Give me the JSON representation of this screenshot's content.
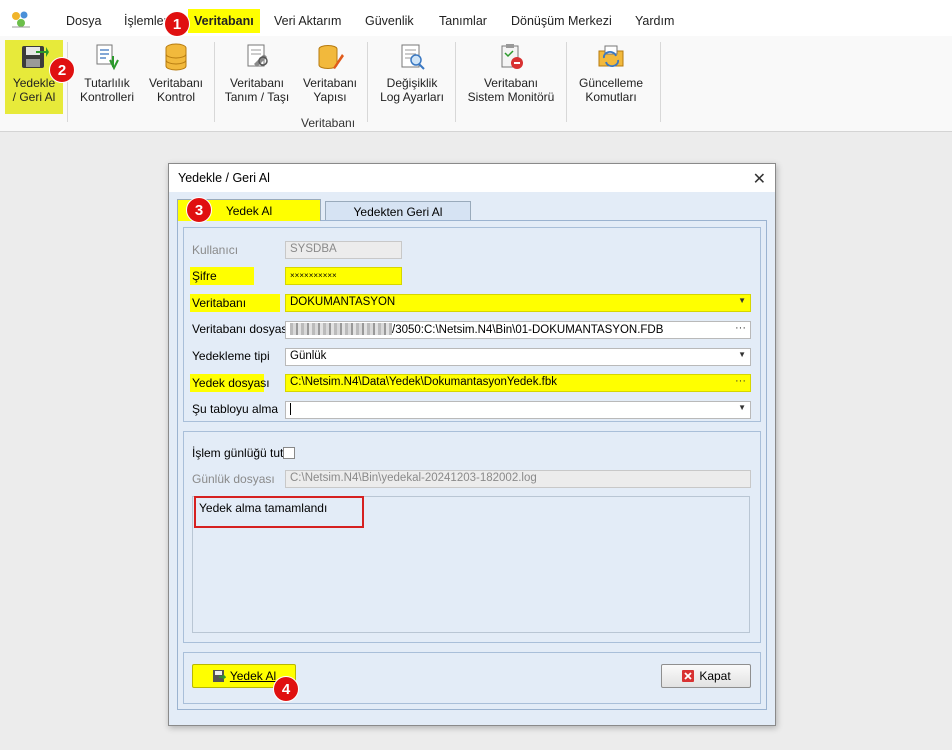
{
  "menu": {
    "items": [
      "Dosya",
      "İşlemler",
      "Veritabanı",
      "Veri Aktarım",
      "Güvenlik",
      "Tanımlar",
      "Dönüşüm Merkezi",
      "Yardım"
    ],
    "active": "Veritabanı"
  },
  "ribbon": {
    "buttons": [
      {
        "line1": "Yedekle",
        "line2": "/ Geri Al",
        "icon": "backup-restore-icon"
      },
      {
        "line1": "Tutarlılık",
        "line2": "Kontrolleri",
        "icon": "consistency-check-icon"
      },
      {
        "line1": "Veritabanı",
        "line2": "Kontrol",
        "icon": "database-icon"
      },
      {
        "line1": "Veritabanı",
        "line2": "Tanım / Taşı",
        "icon": "database-definition-icon"
      },
      {
        "line1": "Veritabanı",
        "line2": "Yapısı",
        "icon": "database-structure-icon"
      },
      {
        "line1": "Değişiklik",
        "line2": "Log Ayarları",
        "icon": "change-log-icon"
      },
      {
        "line1": "Veritabanı",
        "line2": "Sistem Monitörü",
        "icon": "system-monitor-icon"
      },
      {
        "line1": "Güncelleme",
        "line2": "Komutları",
        "icon": "update-commands-icon"
      }
    ],
    "group_label": "Veritabanı"
  },
  "badges": [
    "1",
    "2",
    "3",
    "4"
  ],
  "dialog": {
    "title": "Yedekle / Geri Al",
    "close": "✕",
    "tabs": [
      "Yedek Al",
      "Yedekten Geri Al"
    ],
    "fields": {
      "user_label": "Kullanıcı",
      "user_value": "SYSDBA",
      "password_label": "Şifre",
      "password_value": "××××××××××",
      "database_label": "Veritabanı",
      "database_value": "DOKUMANTASYON",
      "db_file_label": "Veritabanı dosyası",
      "db_file_value": "/3050:C:\\Netsim.N4\\Bin\\01-DOKUMANTASYON.FDB",
      "backup_type_label": "Yedekleme tipi",
      "backup_type_value": "Günlük",
      "backup_file_label": "Yedek dosyası",
      "backup_file_value": "C:\\Netsim.N4\\Data\\Yedek\\DokumantasyonYedek.fbk",
      "skip_table_label": "Şu tabloyu alma",
      "skip_table_value": ""
    },
    "log": {
      "keep_log_label": "İşlem günlüğü tut",
      "keep_log_checked": false,
      "log_file_label": "Günlük dosyası",
      "log_file_value": "C:\\Netsim.N4\\Bin\\yedekal-20241203-182002.log",
      "message": "Yedek alma tamamlandı"
    },
    "buttons": {
      "backup": "Yedek Al",
      "close": "Kapat"
    }
  },
  "colors": {
    "highlight": "#ffff00",
    "badge": "#e01010",
    "dialog_bg": "#e3ecf7",
    "message_border": "#d62020"
  }
}
